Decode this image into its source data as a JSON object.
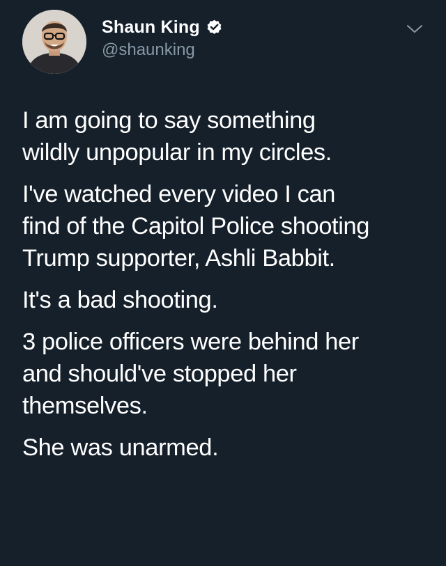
{
  "tweet": {
    "author": {
      "display_name": "Shaun King",
      "handle": "@shaunking",
      "verified": true
    },
    "paragraphs": [
      "I am going to say something\nwildly unpopular in my circles.",
      "I've watched every video I can\nfind of the Capitol Police shooting\nTrump supporter, Ashli Babbit.",
      "It's a bad shooting.",
      "3 police officers were behind her\nand should've stopped her\nthemselves.",
      "She was unarmed."
    ]
  },
  "icons": {
    "verified": "verified-badge-icon",
    "menu": "chevron-down-icon"
  },
  "colors": {
    "background": "#15202b",
    "primary_text": "#ffffff",
    "secondary_text": "#8899a6",
    "verified_badge": "#ffffff"
  }
}
